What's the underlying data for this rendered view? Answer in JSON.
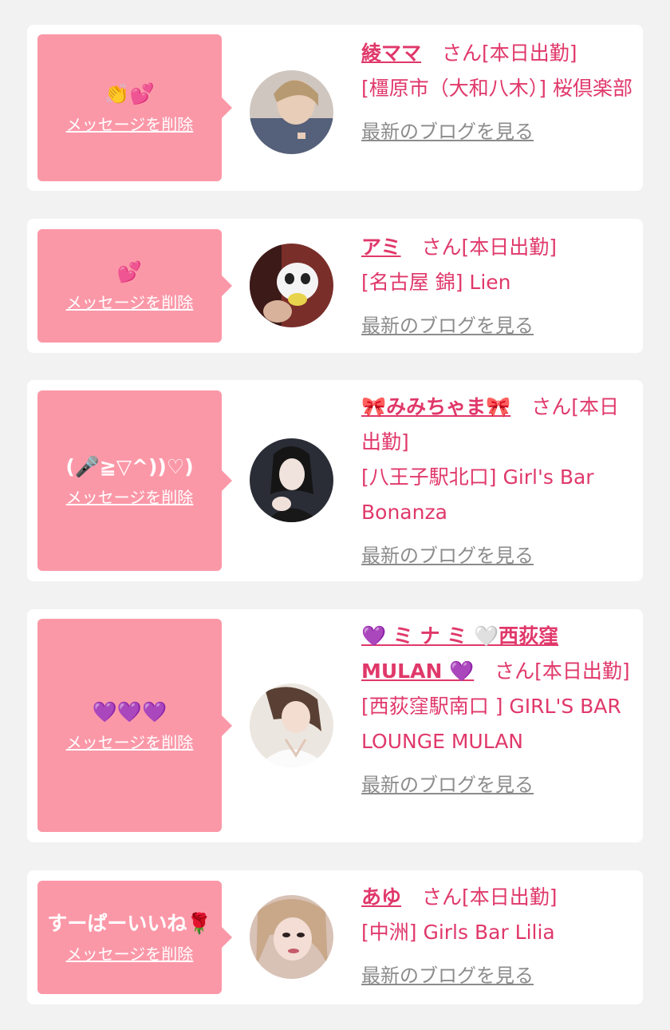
{
  "items": [
    {
      "bubble_message": "👏💕",
      "delete_label": "メッセージを削除",
      "name": "綾ママ",
      "honorific": "さん[本日出勤]",
      "shop": "[橿原市（大和八木）] 桜倶楽部",
      "blog_label": "最新のブログを見る"
    },
    {
      "bubble_message": "💕",
      "delete_label": "メッセージを削除",
      "name": "アミ",
      "honorific": "さん[本日出勤]",
      "shop": "[名古屋 錦] Lien",
      "blog_label": "最新のブログを見る"
    },
    {
      "bubble_message": "(🎤≧▽^))♡)",
      "delete_label": "メッセージを削除",
      "name": "🎀みみちゃま🎀",
      "honorific": "さん[本日出勤]",
      "shop": "[八王子駅北口] Girl's Bar Bonanza",
      "blog_label": "最新のブログを見る"
    },
    {
      "bubble_message": "💜💜💜",
      "delete_label": "メッセージを削除",
      "name": "💜 ミ ナ ミ 🤍西荻窪 MULAN 💜",
      "honorific": "さん[本日出勤]",
      "shop": "[西荻窪駅南口 ] GIRL'S BAR LOUNGE MULAN",
      "blog_label": "最新のブログを見る"
    },
    {
      "bubble_message": "すーぱーいいね🌹",
      "delete_label": "メッセージを削除",
      "name": "あゆ",
      "honorific": "さん[本日出勤]",
      "shop": "[中洲] Girls Bar Lilia",
      "blog_label": "最新のブログを見る"
    }
  ]
}
